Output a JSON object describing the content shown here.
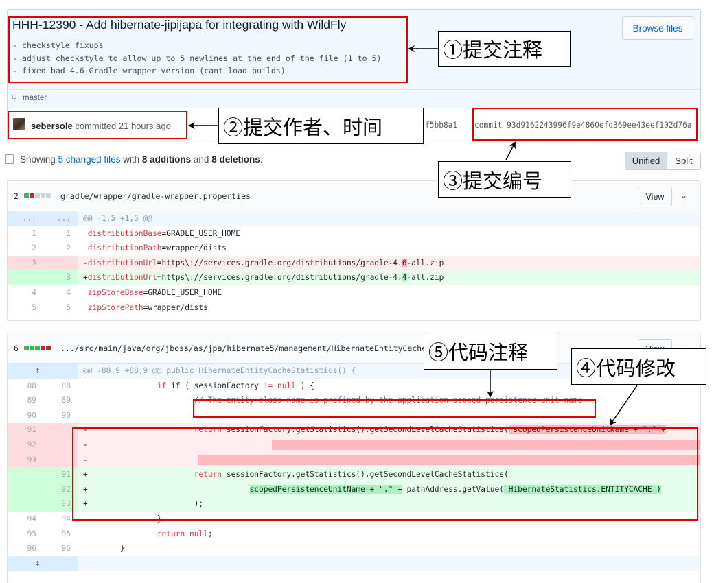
{
  "commit": {
    "title": "HHH-12390 - Add hibernate-jipijapa for integrating with WildFly",
    "message": "- checkstyle fixups\n- adjust checkstyle to allow up to 5 newlines at the end of the file (1 to 5)\n- fixed bad 4.6 Gradle wrapper version (cant load builds)",
    "browse_label": "Browse files",
    "branch": "master",
    "author": "sebersole",
    "committed_text": "committed 21 hours ago",
    "parent_sha": "f5bb8a1",
    "full_sha": "commit 93d9162243996f9e4860efd369ee43eef102d76a"
  },
  "summary": {
    "prefix": "Showing ",
    "files_link": "5 changed files",
    "mid": " with ",
    "additions": "8 additions",
    "and": " and ",
    "deletions": "8 deletions",
    "suffix": "."
  },
  "toggle": {
    "unified": "Unified",
    "split": "Split"
  },
  "files": [
    {
      "changes": "2",
      "path": "gradle/wrapper/gradle-wrapper.properties",
      "view_label": "View",
      "hunk": {
        "old": "...",
        "new": "...",
        "text": "@@ -1,5 +1,5 @@"
      },
      "lines": [
        {
          "old": "1",
          "new": "1",
          "key": "distributionBase",
          "value": "=GRADLE_USER_HOME"
        },
        {
          "old": "2",
          "new": "2",
          "key": "distributionPath",
          "value": "=wrapper/dists"
        },
        {
          "old": "3",
          "new": "",
          "sign": "-",
          "key": "distributionUrl",
          "value_pre": "=https\\://services.gradle.org/distributions/gradle-4.",
          "value_hl": "6",
          "value_post": "-all.zip"
        },
        {
          "old": "",
          "new": "3",
          "sign": "+",
          "key": "distributionUrl",
          "value_pre": "=https\\://services.gradle.org/distributions/gradle-4.",
          "value_hl": "4",
          "value_post": "-all.zip"
        },
        {
          "old": "4",
          "new": "4",
          "key": "zipStoreBase",
          "value": "=GRADLE_USER_HOME"
        },
        {
          "old": "5",
          "new": "5",
          "key": "zipStorePath",
          "value": "=wrapper/dists"
        }
      ]
    },
    {
      "changes": "6",
      "path": ".../src/main/java/org/jboss/as/jpa/hibernate5/management/HibernateEntityCacheS",
      "view_label": "View",
      "hunk": {
        "text": "@@ -88,9 +88,9 @@ public HibernateEntityCacheStatistics() {"
      },
      "lines": {
        "l88": {
          "old": "88",
          "new": "88",
          "pre": "if ( sessionFactory ",
          "op": "!=",
          "mid": " ",
          "kw": "null",
          "post": " ) {"
        },
        "l89": {
          "old": "89",
          "new": "89",
          "comment": "// The entity class name is prefixed by the application scoped persistence unit name"
        },
        "l90": {
          "old": "90",
          "new": "90"
        },
        "l91d": {
          "old": "91",
          "sign": "-",
          "kw": "return",
          "rest": " sessionFactory.getStatistics().getSecondLevelCacheStatistics(",
          "hl": " scopedPersistenceUnitName + \".\" +"
        },
        "l92d": {
          "old": "92",
          "sign": "-"
        },
        "l93d": {
          "old": "93",
          "sign": "-"
        },
        "l91a": {
          "new": "91",
          "sign": "+",
          "kw": "return",
          "rest": " sessionFactory.getStatistics().getSecondLevelCacheStatistics("
        },
        "l92a": {
          "new": "92",
          "sign": "+",
          "hl1": "scopedPersistenceUnitName + \".\" +",
          "mid": " pathAddress.getValue(",
          "hl2": " HibernateStatistics.ENTITYCACHE )"
        },
        "l93a": {
          "new": "93",
          "sign": "+",
          "text": ");"
        },
        "l94": {
          "old": "94",
          "new": "94",
          "text": "}"
        },
        "l95": {
          "old": "95",
          "new": "95",
          "kw": "return",
          "sp": " ",
          "kw2": "null",
          "post": ";"
        },
        "l96": {
          "old": "96",
          "new": "96",
          "text": "}"
        }
      }
    }
  ],
  "annotations": {
    "a1": "①提交注释",
    "a2": "②提交作者、时间",
    "a3": "③提交编号",
    "a4": "④代码修改",
    "a5": "⑤代码注释"
  },
  "colors": {
    "annotation_red": "#e00000",
    "link_blue": "#0366d6",
    "add_green": "#e6ffed",
    "del_red": "#ffeef0"
  }
}
